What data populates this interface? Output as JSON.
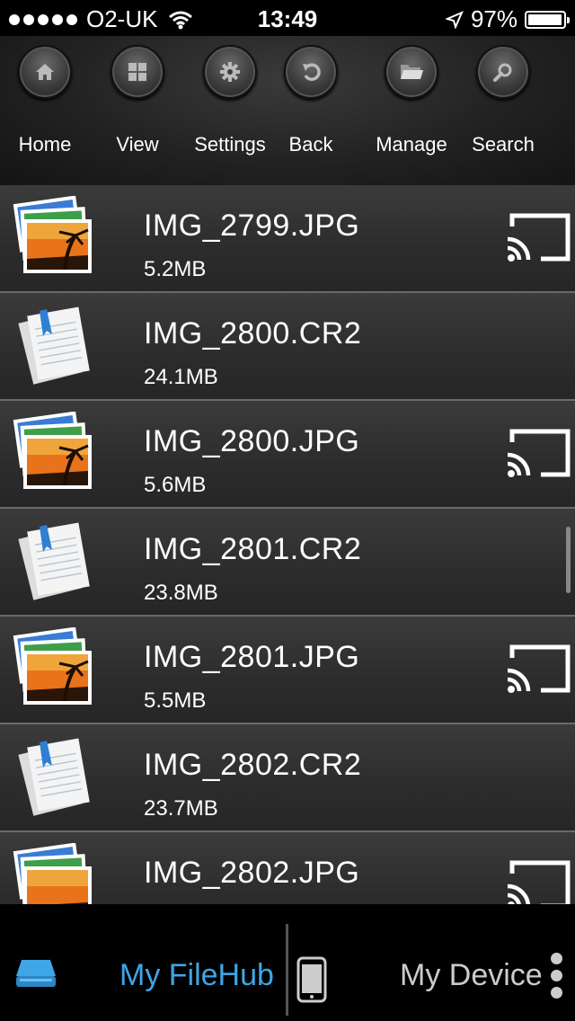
{
  "status_bar": {
    "carrier": "O2-UK",
    "time": "13:49",
    "battery": "97%",
    "battery_level": 0.97,
    "icons": [
      "signal-dots",
      "wifi-icon",
      "location-arrow-icon",
      "battery-icon"
    ]
  },
  "toolbar": {
    "items": [
      {
        "label": "Home",
        "icon": "home-icon"
      },
      {
        "label": "View",
        "icon": "grid-icon"
      },
      {
        "label": "Settings",
        "icon": "gear-icon"
      },
      {
        "label": "Back",
        "icon": "back-arrow-icon"
      },
      {
        "label": "Manage",
        "icon": "folder-icon"
      },
      {
        "label": "Search",
        "icon": "search-icon"
      }
    ]
  },
  "files": [
    {
      "name": "IMG_2799.JPG",
      "size": "5.2MB",
      "type": "photo",
      "cast": true
    },
    {
      "name": "IMG_2800.CR2",
      "size": "24.1MB",
      "type": "document",
      "cast": false
    },
    {
      "name": "IMG_2800.JPG",
      "size": "5.6MB",
      "type": "photo",
      "cast": true
    },
    {
      "name": "IMG_2801.CR2",
      "size": "23.8MB",
      "type": "document",
      "cast": false
    },
    {
      "name": "IMG_2801.JPG",
      "size": "5.5MB",
      "type": "photo",
      "cast": true
    },
    {
      "name": "IMG_2802.CR2",
      "size": "23.7MB",
      "type": "document",
      "cast": false
    },
    {
      "name": "IMG_2802.JPG",
      "size": "",
      "type": "photo",
      "cast": true
    }
  ],
  "tabbar": {
    "filehub_label": "My FileHub",
    "device_label": "My Device",
    "active_color": "#3ea6e6"
  }
}
